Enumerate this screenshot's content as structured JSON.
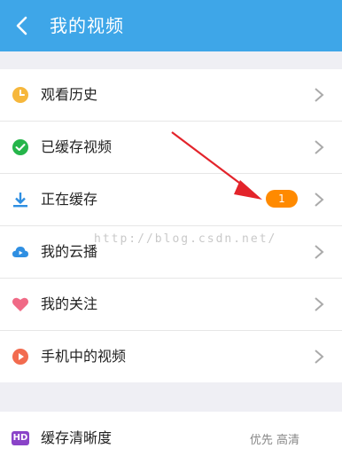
{
  "header": {
    "title": "我的视频"
  },
  "menu": {
    "items": [
      {
        "label": "观看历史"
      },
      {
        "label": "已缓存视频"
      },
      {
        "label": "正在缓存",
        "badge": "1"
      },
      {
        "label": "我的云播"
      },
      {
        "label": "我的关注"
      },
      {
        "label": "手机中的视频"
      }
    ]
  },
  "settings": {
    "label": "缓存清晰度",
    "value": "优先 高清",
    "hd_icon_text": "HD"
  },
  "watermark": "http://blog.csdn.net/",
  "colors": {
    "header": "#3ea6e8",
    "badge": "#ff8a00",
    "history_icon": "#f6b73c",
    "downloaded_icon": "#25b54a",
    "downloading_icon": "#2f8fe2",
    "cloud_icon": "#2f8fe2",
    "follow_icon": "#f06a86",
    "local_icon": "#f26b4f",
    "hd_icon": "#8a43c8",
    "annotation_arrow": "#e3242b"
  },
  "icons": [
    "back-icon",
    "clock-icon",
    "check-circle-icon",
    "download-icon",
    "cloud-play-icon",
    "heart-icon",
    "play-circle-icon",
    "hd-icon",
    "chevron-right-icon"
  ]
}
